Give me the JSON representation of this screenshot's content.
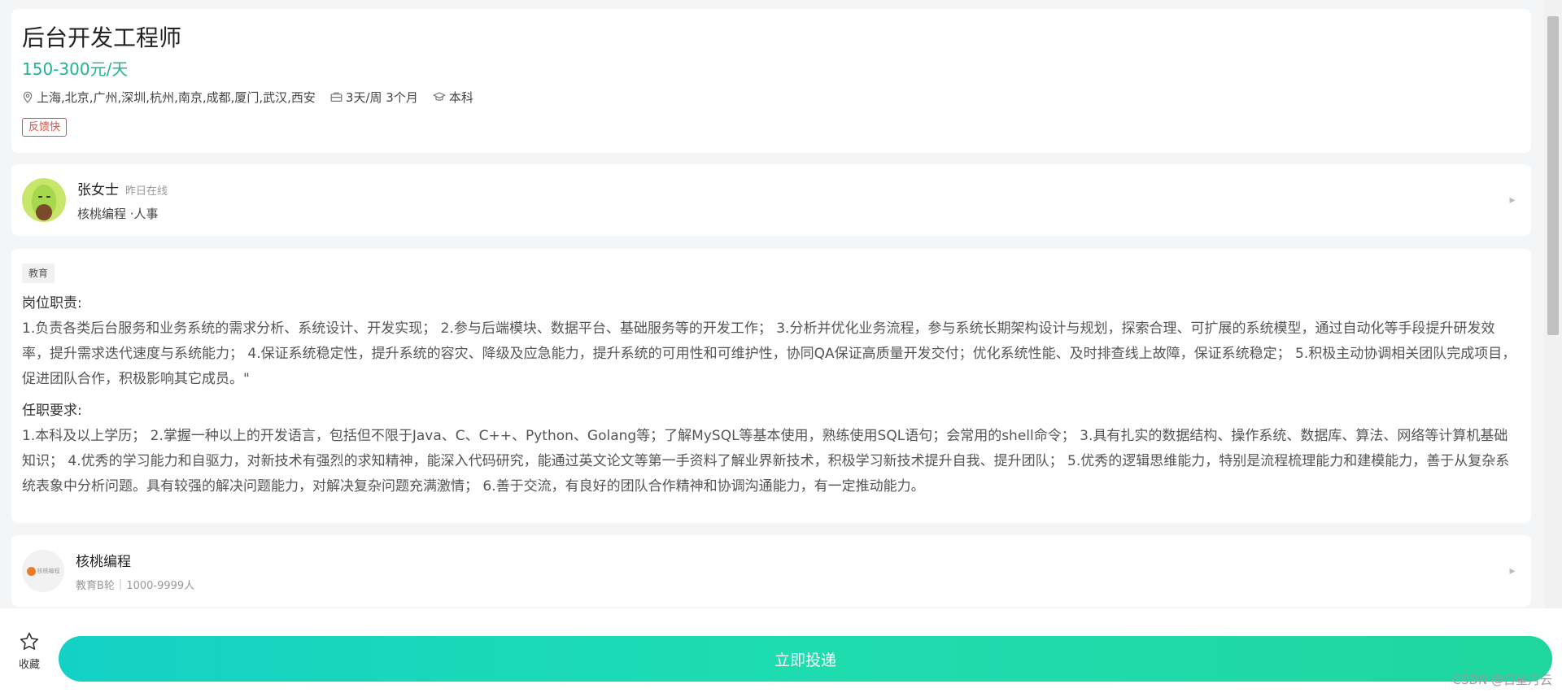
{
  "job": {
    "title": "后台开发工程师",
    "salary": "150-300元/天",
    "location": "上海,北京,广州,深圳,杭州,南京,成都,厦门,武汉,西安",
    "schedule": "3天/周 3个月",
    "education": "本科",
    "feedback_tag": "反馈快"
  },
  "recruiter": {
    "name": "张女士",
    "status": "昨日在线",
    "company_role": "核桃编程 ·人事"
  },
  "description": {
    "industry_tag": "教育",
    "duties_title": "岗位职责:",
    "duties_body": "1.负责各类后台服务和业务系统的需求分析、系统设计、开发实现； 2.参与后端模块、数据平台、基础服务等的开发工作； 3.分析并优化业务流程，参与系统长期架构设计与规划，探索合理、可扩展的系统模型，通过自动化等手段提升研发效率，提升需求迭代速度与系统能力； 4.保证系统稳定性，提升系统的容灾、降级及应急能力，提升系统的可用性和可维护性，协同QA保证高质量开发交付；优化系统性能、及时排查线上故障，保证系统稳定； 5.积极主动协调相关团队完成项目，促进团队合作，积极影响其它成员。\"",
    "requirements_title": "任职要求:",
    "requirements_body": "1.本科及以上学历； 2.掌握一种以上的开发语言，包括但不限于Java、C、C++、Python、Golang等；了解MySQL等基本使用，熟练使用SQL语句；会常用的shell命令； 3.具有扎实的数据结构、操作系统、数据库、算法、网络等计算机基础知识； 4.优秀的学习能力和自驱力，对新技术有强烈的求知精神，能深入代码研究，能通过英文论文等第一手资料了解业界新技术，积极学习新技术提升自我、提升团队； 5.优秀的逻辑思维能力，特别是流程梳理能力和建模能力，善于从复杂系统表象中分析问题。具有较强的解决问题能力，对解决复杂问题充满激情； 6.善于交流，有良好的团队合作精神和协调沟通能力，有一定推动能力。"
  },
  "company": {
    "name": "核桃编程",
    "logo_text": "核桃编程",
    "stage": "教育B轮",
    "size": "1000-9999人"
  },
  "bottom": {
    "favorite_label": "收藏",
    "apply_label": "立即投递"
  },
  "watermark": "CSDN @日星月云",
  "colors": {
    "salary": "#1fb394",
    "feedback_tag": "#e94b3c",
    "apply_gradient_start": "#14d1c6",
    "apply_gradient_end": "#1fd69f"
  },
  "icons": {
    "location": "location-pin-icon",
    "schedule": "briefcase-icon",
    "education": "graduation-cap-icon",
    "favorite": "star-outline-icon",
    "chevron": "chevron-right-icon"
  }
}
